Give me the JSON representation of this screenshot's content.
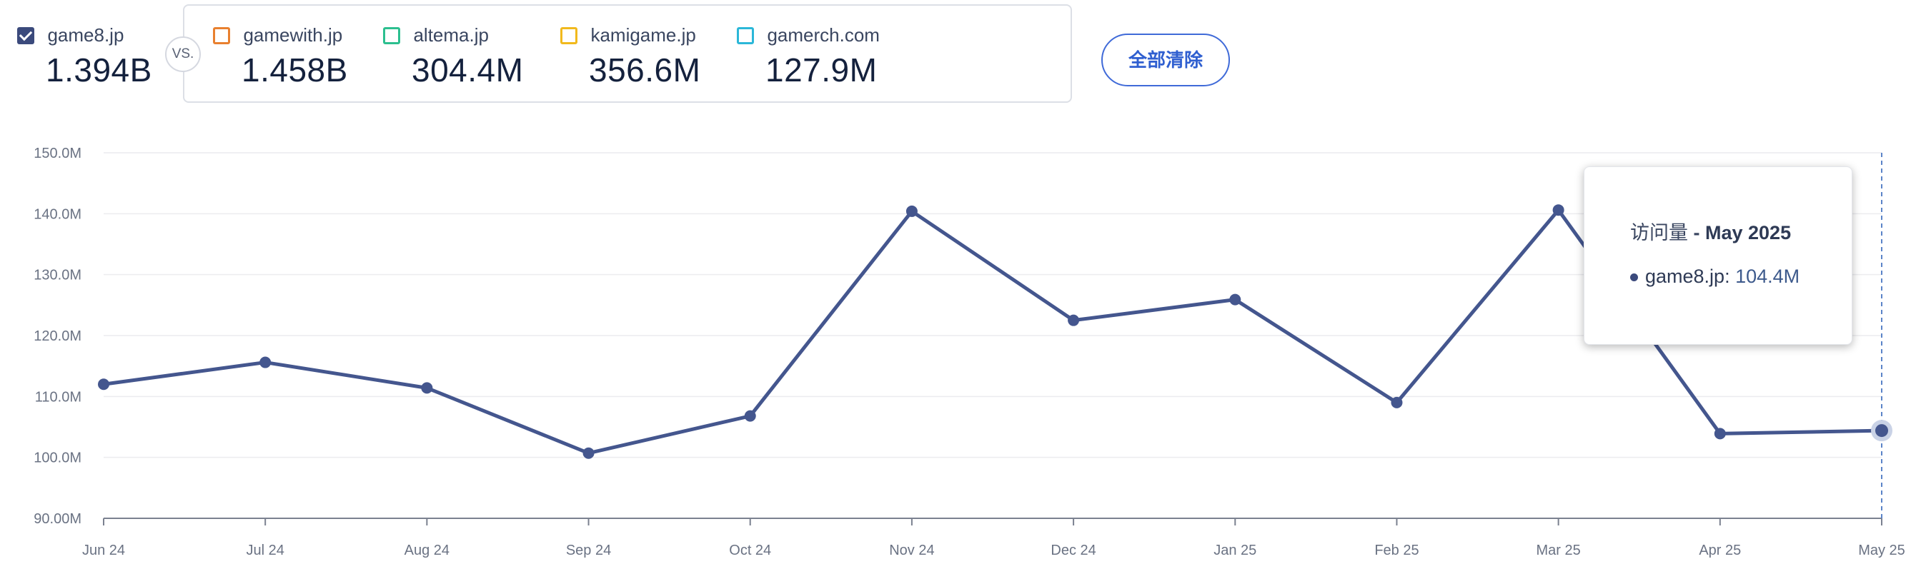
{
  "main_site": {
    "name": "game8.jp",
    "total": "1.394B",
    "checked": true,
    "color": "#3b4a7c"
  },
  "vs_label": "VS.",
  "competitors": [
    {
      "name": "gamewith.jp",
      "total": "1.458B",
      "color": "#e8802f"
    },
    {
      "name": "altema.jp",
      "total": "304.4M",
      "color": "#2cbf8f"
    },
    {
      "name": "kamigame.jp",
      "total": "356.6M",
      "color": "#f1b91d"
    },
    {
      "name": "gamerch.com",
      "total": "127.9M",
      "color": "#2bb7d8"
    }
  ],
  "clear_all_label": "全部清除",
  "tooltip": {
    "metric": "访问量",
    "separator": " - ",
    "month": "May 2025",
    "site": "game8.jp",
    "value": "104.4M"
  },
  "chart_data": {
    "type": "line",
    "categories": [
      "Jun 24",
      "Jul 24",
      "Aug 24",
      "Sep 24",
      "Oct 24",
      "Nov 24",
      "Dec 24",
      "Jan 25",
      "Feb 25",
      "Mar 25",
      "Apr 25",
      "May 25"
    ],
    "series": [
      {
        "name": "game8.jp",
        "color": "#44568e",
        "values": [
          112.0,
          115.6,
          111.4,
          100.7,
          106.8,
          140.4,
          122.5,
          125.9,
          109.0,
          140.6,
          103.9,
          104.4
        ]
      }
    ],
    "ylim": [
      90,
      150
    ],
    "yticks": [
      90,
      100,
      110,
      120,
      130,
      140,
      150
    ],
    "ytick_labels": [
      "90.00M",
      "100.0M",
      "110.0M",
      "120.0M",
      "130.0M",
      "140.0M",
      "150.0M"
    ],
    "xlabel": "",
    "ylabel": "",
    "grid": true,
    "highlight_index": 11
  }
}
